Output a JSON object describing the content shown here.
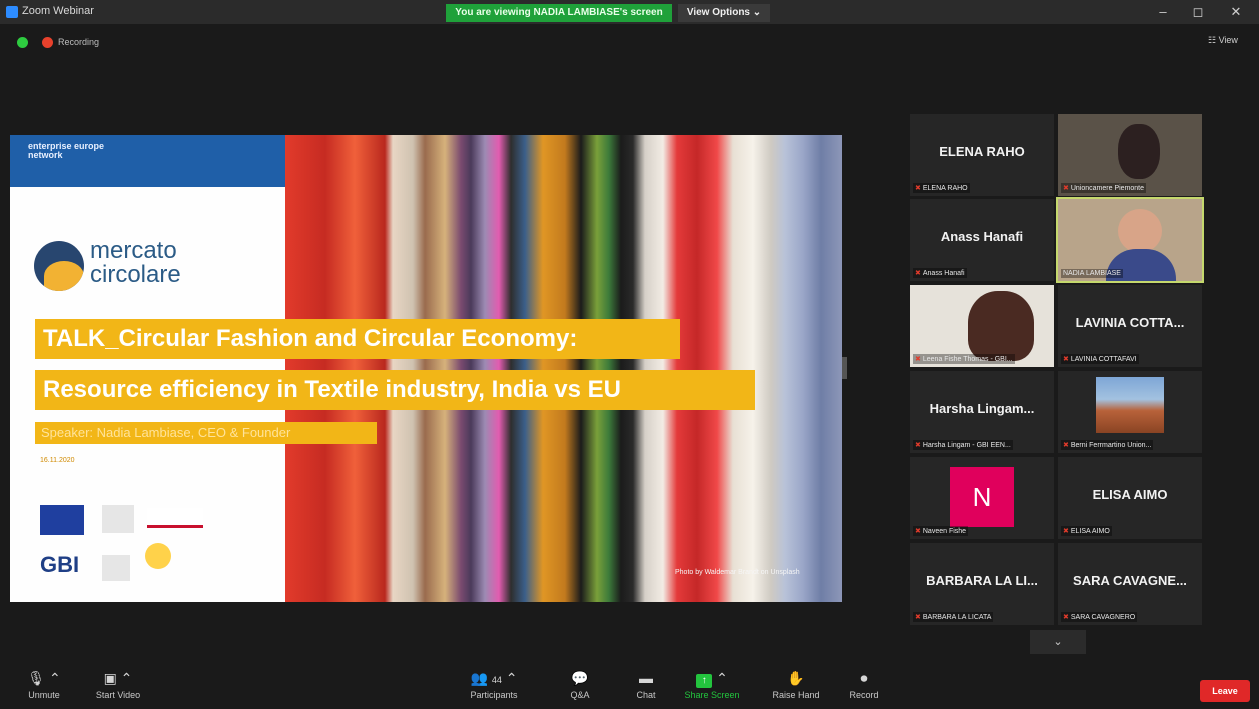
{
  "window": {
    "title": "Zoom Webinar",
    "viewing_banner": "You are viewing NADIA LAMBIASE's screen",
    "view_options": "View Options ⌄",
    "minimize": "–",
    "maximize": "◻",
    "close": "✕"
  },
  "status": {
    "recording_label": "Recording",
    "view_label": "☷ View"
  },
  "slide": {
    "een_logo": "enterprise europe network",
    "mc_line1": "mercato",
    "mc_line2": "circolare",
    "title_line1": "TALK_Circular Fashion and Circular Economy:",
    "title_line2": "Resource efficiency in Textile industry, India vs EU",
    "speaker": "Speaker: Nadia Lambiase, CEO & Founder",
    "date": "16.11.2020",
    "gbi_logo": "GBI",
    "photo_credit": "Photo by Waldemar Brandt on Unsplash"
  },
  "gallery": [
    {
      "big_name": "ELENA RAHO",
      "label": "ELENA RAHO",
      "video": false
    },
    {
      "big_name": "",
      "label": "Unioncamere Piemonte",
      "video": true
    },
    {
      "big_name": "Anass Hanafi",
      "label": "Anass Hanafi",
      "video": false
    },
    {
      "big_name": "",
      "label": "NADIA LAMBIASE",
      "video": true
    },
    {
      "big_name": "",
      "label": "Leena Fishe Thomas - GBI...",
      "video": true
    },
    {
      "big_name": "LAVINIA COTTA...",
      "label": "LAVINIA COTTAFAVI",
      "video": false
    },
    {
      "big_name": "Harsha Lingam...",
      "label": "Harsha Lingam - GBI EEN...",
      "video": false
    },
    {
      "big_name": "",
      "label": "Berni Ferrmartino Union...",
      "video": true
    },
    {
      "big_name": "",
      "label": "Naveen Fishe",
      "avatar": "N"
    },
    {
      "big_name": "ELISA AIMO",
      "label": "ELISA AIMO",
      "video": false
    },
    {
      "big_name": "BARBARA LA LI...",
      "label": "BARBARA LA LICATA",
      "video": false
    },
    {
      "big_name": "SARA CAVAGNE...",
      "label": "SARA CAVAGNERO",
      "video": false
    }
  ],
  "toolbar": {
    "unmute": "Unmute",
    "start_video": "Start Video",
    "participants": "Participants",
    "participants_count": "44",
    "qa": "Q&A",
    "chat": "Chat",
    "share_screen": "Share Screen",
    "raise_hand": "Raise Hand",
    "record": "Record",
    "leave": "Leave"
  },
  "colors": {
    "share_green": "#23c43e",
    "leave_red": "#e02828",
    "slide_yellow": "#f2b617",
    "active_speaker": "#c5d86d"
  }
}
